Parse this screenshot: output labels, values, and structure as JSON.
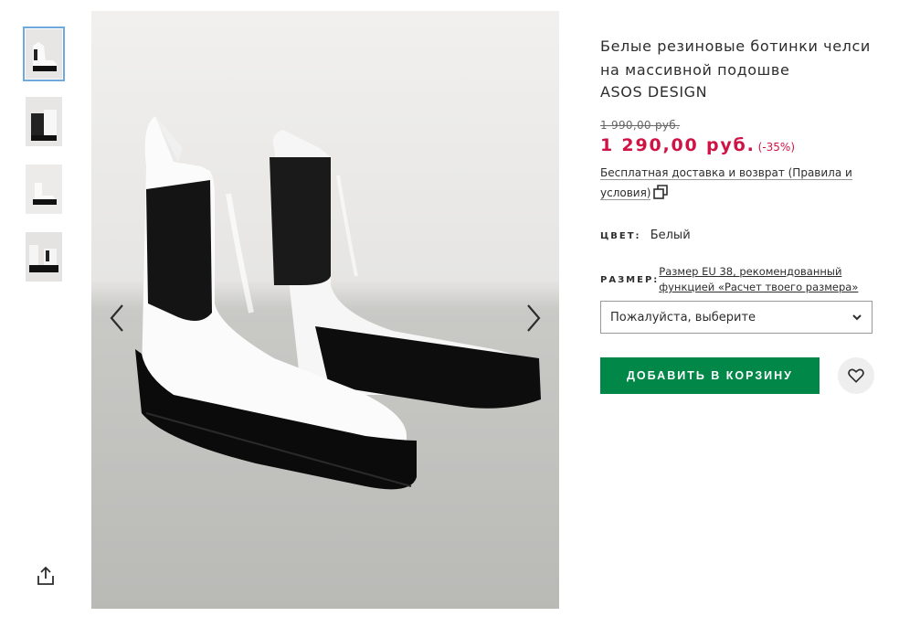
{
  "product": {
    "title": "Белые резиновые ботинки челси на массивной подошве",
    "brand": "ASOS DESIGN",
    "old_price": "1 990,00 руб.",
    "price": "1 290,00 руб.",
    "discount": "(-35%)",
    "delivery_text": "Бесплатная доставка и возврат (Правила и условия)"
  },
  "color": {
    "label": "ЦВЕТ:",
    "value": "Белый"
  },
  "size": {
    "label": "РАЗМЕР:",
    "guide_link": "Размер EU 38, рекомендованный функцией «Расчет твоего размера»",
    "select_placeholder": "Пожалуйста, выберите"
  },
  "actions": {
    "add_to_bag": "ДОБАВИТЬ В КОРЗИНУ"
  },
  "colors": {
    "price_red": "#d01345",
    "button_green": "#018849"
  },
  "icons": [
    "share-icon",
    "chevron-left-icon",
    "chevron-right-icon",
    "copy-icon",
    "chevron-down-icon",
    "heart-icon"
  ]
}
